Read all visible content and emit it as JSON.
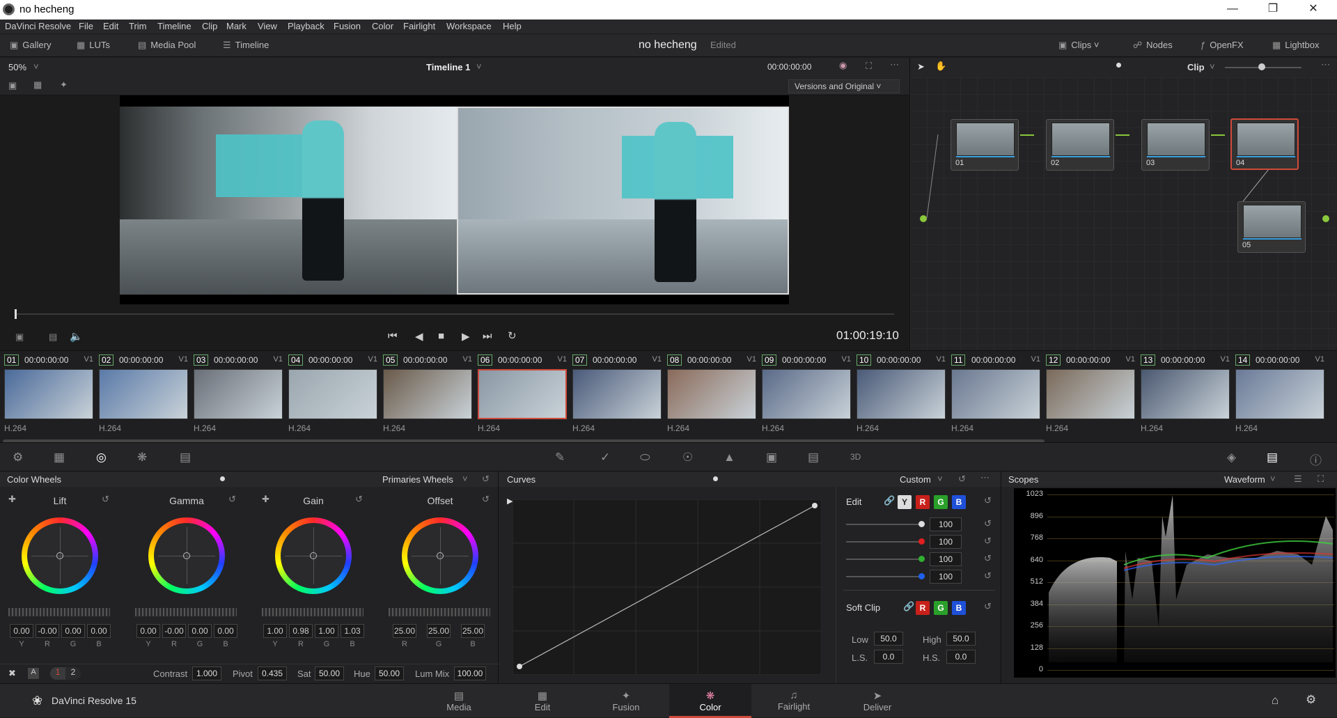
{
  "window": {
    "title": "no hecheng"
  },
  "menu": [
    "DaVinci Resolve",
    "File",
    "Edit",
    "Trim",
    "Timeline",
    "Clip",
    "Mark",
    "View",
    "Playback",
    "Fusion",
    "Color",
    "Fairlight",
    "Workspace",
    "Help"
  ],
  "toolbar": {
    "gallery": "Gallery",
    "luts": "LUTs",
    "media_pool": "Media Pool",
    "timeline": "Timeline",
    "project": "no hecheng",
    "status": "Edited",
    "clips": "Clips",
    "nodes": "Nodes",
    "openfx": "OpenFX",
    "lightbox": "Lightbox"
  },
  "viewer": {
    "zoom": "50%",
    "timeline_name": "Timeline 1",
    "timecode": "00:00:00:00",
    "versions": "Versions and Original",
    "clip_mode": "Clip",
    "record_tc": "01:00:19:10"
  },
  "clips": [
    {
      "num": "01",
      "tc": "00:00:00:00",
      "track": "V1",
      "codec": "H.264"
    },
    {
      "num": "02",
      "tc": "00:00:00:00",
      "track": "V1",
      "codec": "H.264"
    },
    {
      "num": "03",
      "tc": "00:00:00:00",
      "track": "V1",
      "codec": "H.264"
    },
    {
      "num": "04",
      "tc": "00:00:00:00",
      "track": "V1",
      "codec": "H.264"
    },
    {
      "num": "05",
      "tc": "00:00:00:00",
      "track": "V1",
      "codec": "H.264"
    },
    {
      "num": "06",
      "tc": "00:00:00:00",
      "track": "V1",
      "codec": "H.264"
    },
    {
      "num": "07",
      "tc": "00:00:00:00",
      "track": "V1",
      "codec": "H.264"
    },
    {
      "num": "08",
      "tc": "00:00:00:00",
      "track": "V1",
      "codec": "H.264"
    },
    {
      "num": "09",
      "tc": "00:00:00:00",
      "track": "V1",
      "codec": "H.264"
    },
    {
      "num": "10",
      "tc": "00:00:00:00",
      "track": "V1",
      "codec": "H.264"
    },
    {
      "num": "11",
      "tc": "00:00:00:00",
      "track": "V1",
      "codec": "H.264"
    },
    {
      "num": "12",
      "tc": "00:00:00:00",
      "track": "V1",
      "codec": "H.264"
    },
    {
      "num": "13",
      "tc": "00:00:00:00",
      "track": "V1",
      "codec": "H.264"
    },
    {
      "num": "14",
      "tc": "00:00:00:00",
      "track": "V1",
      "codec": "H.264"
    }
  ],
  "nodes": [
    {
      "label": "01"
    },
    {
      "label": "02"
    },
    {
      "label": "03"
    },
    {
      "label": "04"
    },
    {
      "label": "05"
    }
  ],
  "color_wheels": {
    "title": "Color Wheels",
    "mode": "Primaries Wheels",
    "wheels": [
      {
        "name": "Lift",
        "values": [
          "0.00",
          "-0.00",
          "0.00",
          "0.00"
        ],
        "subs": [
          "Y",
          "R",
          "G",
          "B"
        ]
      },
      {
        "name": "Gamma",
        "values": [
          "0.00",
          "-0.00",
          "0.00",
          "0.00"
        ],
        "subs": [
          "Y",
          "R",
          "G",
          "B"
        ]
      },
      {
        "name": "Gain",
        "values": [
          "1.00",
          "0.98",
          "1.00",
          "1.03"
        ],
        "subs": [
          "Y",
          "R",
          "G",
          "B"
        ]
      },
      {
        "name": "Offset",
        "values": [
          "25.00",
          "25.00",
          "25.00"
        ],
        "subs": [
          "R",
          "G",
          "B"
        ]
      }
    ],
    "pages": [
      "1",
      "2"
    ],
    "contrast_label": "Contrast",
    "contrast": "1.000",
    "pivot_label": "Pivot",
    "pivot": "0.435",
    "sat_label": "Sat",
    "sat": "50.00",
    "hue_label": "Hue",
    "hue": "50.00",
    "lummix_label": "Lum Mix",
    "lummix": "100.00"
  },
  "curves": {
    "title": "Curves",
    "mode": "Custom",
    "edit_label": "Edit",
    "channels": [
      "Y",
      "R",
      "G",
      "B"
    ],
    "values": [
      "100",
      "100",
      "100",
      "100"
    ],
    "softclip_label": "Soft Clip",
    "low_label": "Low",
    "low": "50.0",
    "high_label": "High",
    "high": "50.0",
    "ls_label": "L.S.",
    "ls": "0.0",
    "hs_label": "H.S.",
    "hs": "0.0"
  },
  "scopes": {
    "title": "Scopes",
    "mode": "Waveform",
    "ticks": [
      "1023",
      "896",
      "768",
      "640",
      "512",
      "384",
      "256",
      "128",
      "0"
    ]
  },
  "pages": [
    {
      "label": "Media"
    },
    {
      "label": "Edit"
    },
    {
      "label": "Fusion"
    },
    {
      "label": "Color"
    },
    {
      "label": "Fairlight"
    },
    {
      "label": "Deliver"
    }
  ],
  "app": {
    "name": "DaVinci Resolve 15"
  }
}
